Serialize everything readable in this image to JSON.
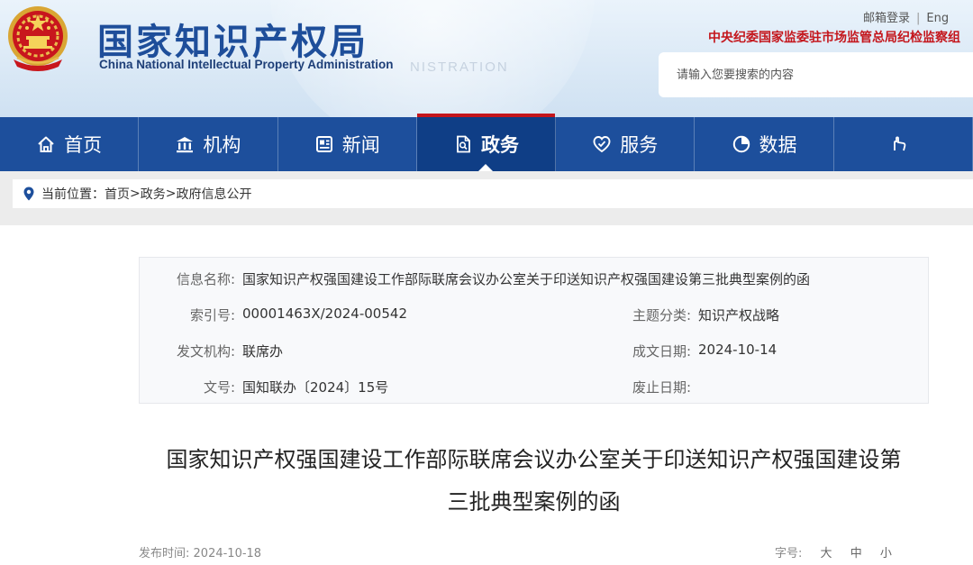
{
  "header": {
    "site_title": "国家知识产权局",
    "site_subtitle": "China National Intellectual Property Administration",
    "watermark": "NISTRATION",
    "top_links": {
      "mail_login": "邮箱登录",
      "english": "Eng"
    },
    "inspect_link": "中央纪委国家监委驻市场监管总局纪检监察组",
    "search": {
      "placeholder": "请输入您要搜索的内容"
    },
    "brand_color": "#1e4e9a",
    "accent_red": "#c4161c"
  },
  "nav": {
    "active": "政务",
    "items": [
      {
        "label": "首页",
        "icon": "home-icon"
      },
      {
        "label": "机构",
        "icon": "institution-icon"
      },
      {
        "label": "新闻",
        "icon": "news-icon"
      },
      {
        "label": "政务",
        "icon": "government-affairs-icon"
      },
      {
        "label": "服务",
        "icon": "service-icon"
      },
      {
        "label": "数据",
        "icon": "data-pie-icon"
      }
    ],
    "bg_color": "#1d4f9c"
  },
  "breadcrumb": {
    "prefix": "当前位置：",
    "items": [
      "首页",
      "政务",
      "政府信息公开"
    ],
    "separator": ">"
  },
  "info": {
    "name_label": "信息名称:",
    "name_value": "国家知识产权强国建设工作部际联席会议办公室关于印送知识产权强国建设第三批典型案例的函",
    "index_label": "索引号:",
    "index_value": "00001463X/2024-00542",
    "topic_label": "主题分类:",
    "topic_value": "知识产权战略",
    "issuer_label": "发文机构:",
    "issuer_value": "联席办",
    "date_label": "成文日期:",
    "date_value": "2024-10-14",
    "docno_label": "文号:",
    "docno_value": "国知联办〔2024〕15号",
    "expire_label": "废止日期:",
    "expire_value": ""
  },
  "article": {
    "title_line1": "国家知识产权强国建设工作部际联席会议办公室关于印送知识产权强国建设第",
    "title_line2": "三批典型案例的函",
    "publish_label": "发布时间:",
    "publish_date": "2024-10-18",
    "fontsize_label": "字号:",
    "fontsize_options": [
      "大",
      "中",
      "小"
    ]
  }
}
